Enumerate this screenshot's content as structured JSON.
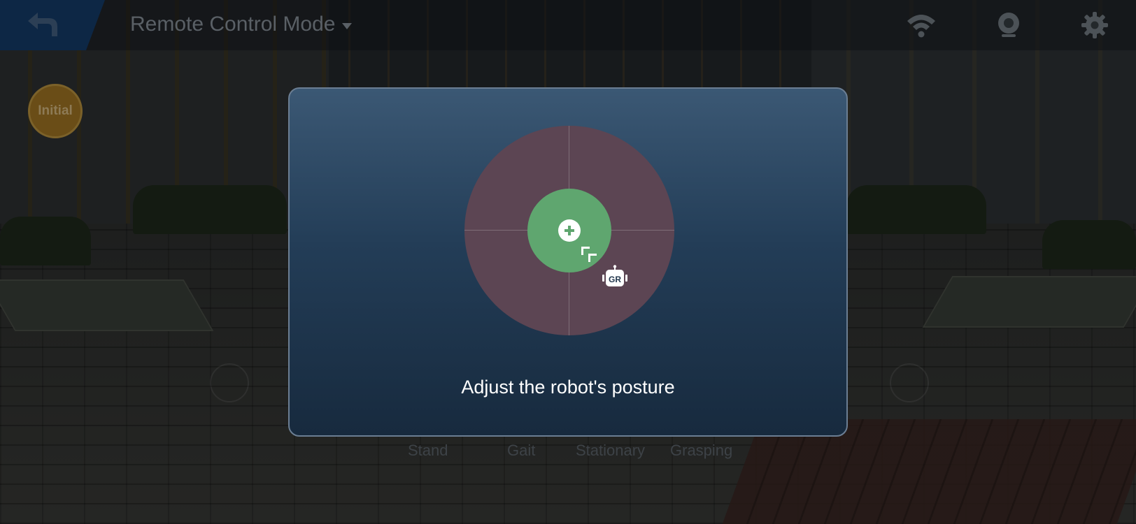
{
  "header": {
    "mode_label": "Remote Control Mode",
    "back_icon": "back-arrow-icon",
    "wifi_icon": "wifi-icon",
    "camera_icon": "camera-icon",
    "settings_icon": "gear-icon"
  },
  "side": {
    "initial_label": "Initial"
  },
  "bottom_tabs": [
    "Stand",
    "Gait",
    "Stationary",
    "Grasping"
  ],
  "dialog": {
    "message": "Adjust the robot's posture",
    "robot_badge": "GR"
  },
  "colors": {
    "accent_blue": "#0d2745",
    "safe_zone": "#5fa66f",
    "outer_zone": "#5c4553",
    "initial_button": "#6a4d17"
  }
}
